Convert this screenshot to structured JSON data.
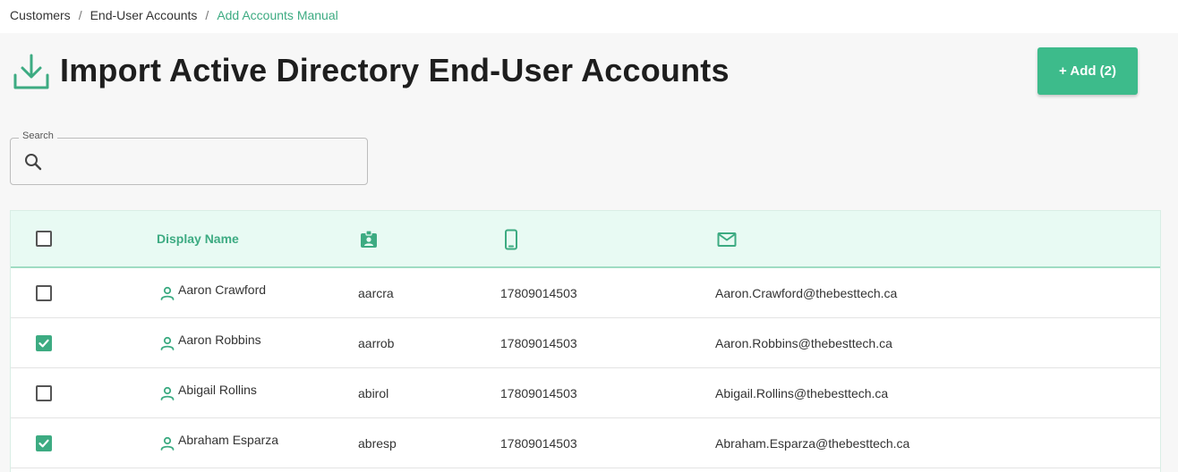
{
  "breadcrumb": {
    "items": [
      "Customers",
      "End-User Accounts",
      "Add Accounts Manual"
    ],
    "separator": "/"
  },
  "page": {
    "title": "Import Active Directory End-User Accounts",
    "icon": "download-icon"
  },
  "toolbar": {
    "add_label": "+ Add (2)"
  },
  "search": {
    "label": "Search",
    "value": "",
    "placeholder": ""
  },
  "table": {
    "columns": {
      "display_name": "Display Name",
      "username_icon": "contact-badge-icon",
      "phone_icon": "mobile-phone-icon",
      "email_icon": "envelope-icon"
    },
    "rows": [
      {
        "checked": false,
        "display_name": "Aaron Crawford",
        "username": "aarcra",
        "phone": "17809014503",
        "email": "Aaron.Crawford@thebesttech.ca"
      },
      {
        "checked": true,
        "display_name": "Aaron Robbins",
        "username": "aarrob",
        "phone": "17809014503",
        "email": "Aaron.Robbins@thebesttech.ca"
      },
      {
        "checked": false,
        "display_name": "Abigail Rollins",
        "username": "abirol",
        "phone": "17809014503",
        "email": "Abigail.Rollins@thebesttech.ca"
      },
      {
        "checked": true,
        "display_name": "Abraham Esparza",
        "username": "abresp",
        "phone": "17809014503",
        "email": "Abraham.Esparza@thebesttech.ca"
      }
    ]
  },
  "colors": {
    "accent": "#3dab82",
    "button": "#3dbb8b",
    "header_bg": "#e8faf3"
  }
}
